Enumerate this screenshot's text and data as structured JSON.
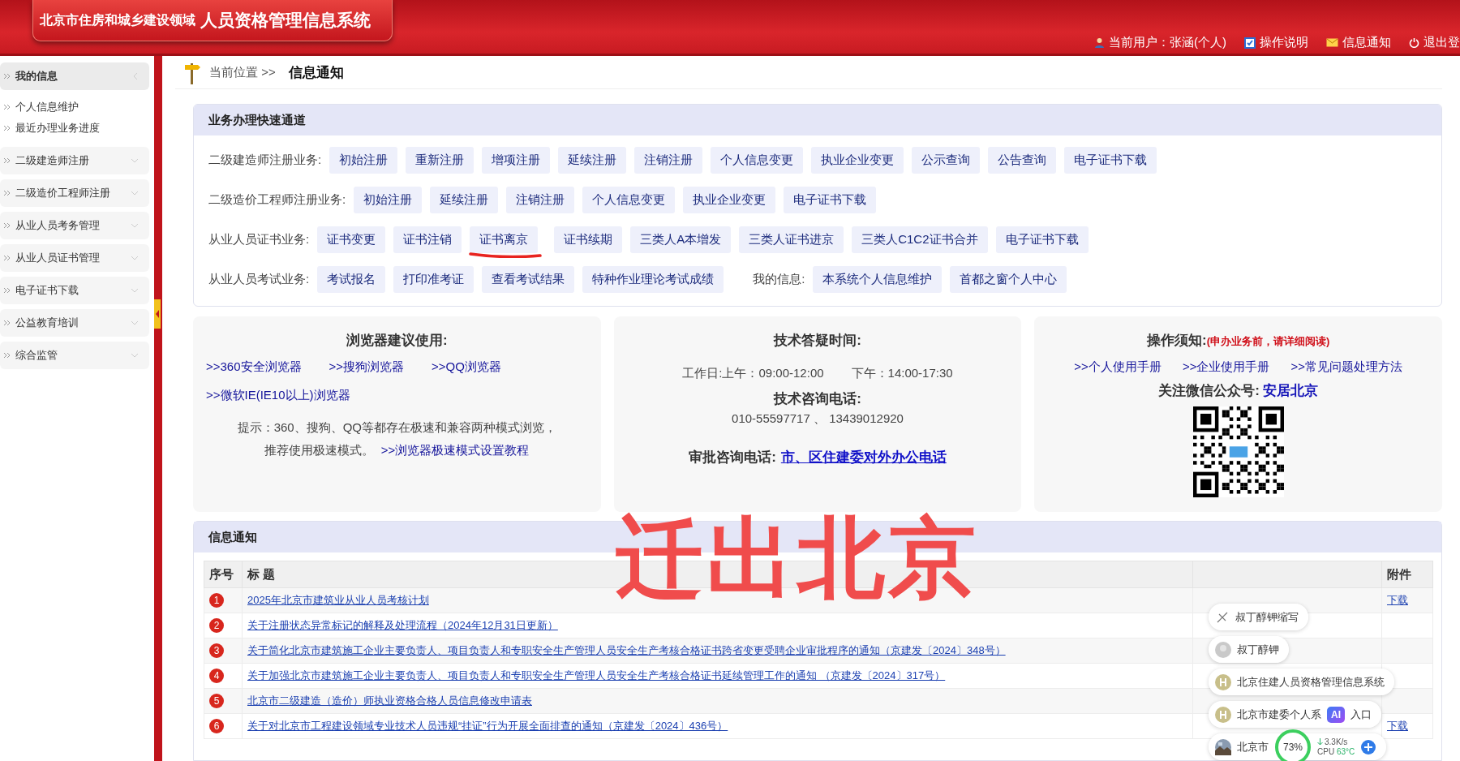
{
  "header": {
    "org": "北京市住房和城乡建设领域",
    "system": "人员资格管理信息系统",
    "user": "当前用户：张涵(个人)",
    "links": [
      {
        "label": "操作说明",
        "kind": "help"
      },
      {
        "label": "信息通知",
        "kind": "mail"
      },
      {
        "label": "退出登",
        "kind": "power"
      }
    ]
  },
  "sidebar": [
    {
      "label": "我的信息",
      "expanded": true,
      "children": [
        {
          "label": "个人信息维护"
        },
        {
          "label": "最近办理业务进度"
        }
      ]
    },
    {
      "label": "二级建造师注册",
      "expanded": false
    },
    {
      "label": "二级造价工程师注册",
      "expanded": false
    },
    {
      "label": "从业人员考务管理",
      "expanded": false
    },
    {
      "label": "从业人员证书管理",
      "expanded": false
    },
    {
      "label": "电子证书下载",
      "expanded": false
    },
    {
      "label": "公益教育培训",
      "expanded": false
    },
    {
      "label": "综合监管",
      "expanded": false
    }
  ],
  "breadcrumb": {
    "label": "当前位置 >>",
    "current": "信息通知"
  },
  "quick": {
    "title": "业务办理快速通道",
    "rows": [
      {
        "groups": [
          {
            "label": "二级建造师注册业务:",
            "buttons": [
              {
                "label": "初始注册",
                "marked": false
              },
              {
                "label": "重新注册",
                "marked": false
              },
              {
                "label": "增项注册",
                "marked": false
              },
              {
                "label": "延续注册",
                "marked": false
              },
              {
                "label": "注销注册",
                "marked": false
              },
              {
                "label": "个人信息变更",
                "marked": false
              },
              {
                "label": "执业企业变更",
                "marked": false
              },
              {
                "label": "公示查询",
                "marked": false
              },
              {
                "label": "公告查询",
                "marked": false
              },
              {
                "label": "电子证书下载",
                "marked": false
              }
            ]
          }
        ]
      },
      {
        "groups": [
          {
            "label": "二级造价工程师注册业务:",
            "buttons": [
              {
                "label": "初始注册",
                "marked": false
              },
              {
                "label": "延续注册",
                "marked": false
              },
              {
                "label": "注销注册",
                "marked": false
              },
              {
                "label": "个人信息变更",
                "marked": false
              },
              {
                "label": "执业企业变更",
                "marked": false
              },
              {
                "label": "电子证书下载",
                "marked": false
              }
            ]
          }
        ]
      },
      {
        "groups": [
          {
            "label": "从业人员证书业务:",
            "buttons": [
              {
                "label": "证书变更",
                "marked": false
              },
              {
                "label": "证书注销",
                "marked": false
              },
              {
                "label": "证书离京",
                "marked": true
              },
              {
                "label": "证书续期",
                "marked": false
              },
              {
                "label": "三类人A本增发",
                "marked": false
              },
              {
                "label": "三类人证书进京",
                "marked": false
              },
              {
                "label": "三类人C1C2证书合并",
                "marked": false
              },
              {
                "label": "电子证书下载",
                "marked": false
              }
            ]
          }
        ]
      },
      {
        "groups": [
          {
            "label": "从业人员考试业务:",
            "buttons": [
              {
                "label": "考试报名",
                "marked": false
              },
              {
                "label": "打印准考证",
                "marked": false
              },
              {
                "label": "查看考试结果",
                "marked": false
              },
              {
                "label": "特种作业理论考试成绩",
                "marked": false
              }
            ]
          },
          {
            "label": "我的信息:",
            "buttons": [
              {
                "label": "本系统个人信息维护",
                "marked": false
              },
              {
                "label": "首都之窗个人中心",
                "marked": false
              }
            ]
          }
        ]
      }
    ]
  },
  "browser_card": {
    "title": "浏览器建议使用:",
    "links": [
      ">>360安全浏览器",
      ">>搜狗浏览器",
      ">>QQ浏览器",
      ">>微软IE(IE10以上)浏览器"
    ],
    "tip": "提示：360、搜狗、QQ等都存在极速和兼容两种模式浏览，推荐使用极速模式。",
    "tip_link": ">>浏览器极速模式设置教程"
  },
  "support_card": {
    "title": "技术答疑时间:",
    "hours_am": "工作日:上午：09:00-12:00",
    "hours_pm": "下午：14:00-17:30",
    "phone_title": "技术咨询电话:",
    "phones": "010-55597717 、 13439012920",
    "approval_label": "审批咨询电话:",
    "approval_link": "市、区住建委对外办公电话"
  },
  "guide_card": {
    "title": "操作须知:",
    "note": "(申办业务前，请详细阅读)",
    "links": [
      ">>个人使用手册",
      ">>企业使用手册",
      ">>常见问题处理方法"
    ],
    "wechat_label": "关注微信公众号:",
    "wechat_name": "安居北京"
  },
  "notices": {
    "title": "信息通知",
    "columns": [
      "序号",
      "标 题",
      "附件"
    ],
    "rows": [
      {
        "no": "1",
        "title": "2025年北京市建筑业从业人员考核计划",
        "attachment": "下载"
      },
      {
        "no": "2",
        "title": "关于注册状态异常标记的解释及处理流程（2024年12月31日更新）"
      },
      {
        "no": "3",
        "title": "关于简化北京市建筑施工企业主要负责人、项目负责人和专职安全生产管理人员安全生产考核合格证书跨省变更受聘企业审批程序的通知（京建发〔2024〕348号）"
      },
      {
        "no": "4",
        "title": "关于加强北京市建筑施工企业主要负责人、项目负责人和专职安全生产管理人员安全生产考核合格证书延续管理工作的通知 （京建发〔2024〕317号）"
      },
      {
        "no": "5",
        "title": "北京市二级建造（造价）师执业资格合格人员信息修改申请表"
      },
      {
        "no": "6",
        "title": "关于对北京市工程建设领域专业技术人员违规“挂证”行为开展全面排查的通知（京建发〔2024〕436号）",
        "attachment": "下载"
      }
    ]
  },
  "annotation": {
    "text": "迁出北京"
  },
  "popup": {
    "items": [
      {
        "label": "叔丁醇钾缩写",
        "kind": "search"
      },
      {
        "label": "叔丁醇钾",
        "kind": "history"
      },
      {
        "label": "北京住建人员资格管理信息系统",
        "kind": "site"
      },
      {
        "label": "北京市建委个人系",
        "kind": "site",
        "badge": "AI",
        "tail": "入口"
      },
      {
        "label": "北京市"
      }
    ],
    "meter": {
      "reading": "73%"
    },
    "net": {
      "speed": "3.3K/s",
      "cpu_label": "CPU",
      "cpu_temp": "63°C"
    }
  }
}
